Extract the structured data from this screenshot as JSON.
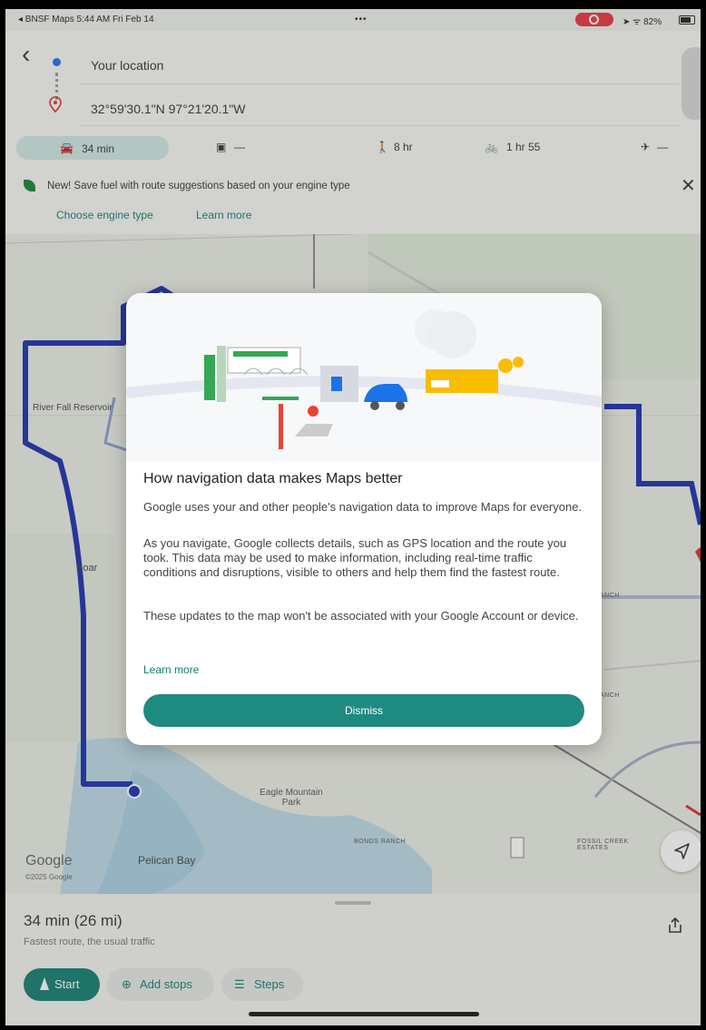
{
  "status_bar": {
    "left_text": "◂ BNSF Maps  5:44 AM  Fri Feb 14",
    "center_text": "•••",
    "right_text": "➤ ᯤ 82%"
  },
  "header": {
    "origin": "Your location",
    "destination": "32°59'30.1\"N 97°21'20.1\"W",
    "modes": [
      {
        "icon": "car-icon",
        "label": "34 min"
      },
      {
        "icon": "transit-icon",
        "label": "—"
      },
      {
        "icon": "walk-icon",
        "label": "8 hr"
      },
      {
        "icon": "bike-icon",
        "label": "1 hr 55"
      },
      {
        "icon": "flight-icon",
        "label": "—"
      }
    ]
  },
  "banner": {
    "text": "New! Save fuel with route suggestions based on your engine type",
    "links": [
      "Choose engine type",
      "Learn more"
    ]
  },
  "map": {
    "labels": [
      "Boar",
      "Pelican Bay",
      "Eagle Mountain Park"
    ],
    "small_labels": [
      "BONDS RANCH",
      "FOSSIL CREEK ESTATES",
      "ANCH",
      "ANCH"
    ],
    "logo": "Google",
    "copyright": "©2025 Google",
    "route_color": "#1a2fae"
  },
  "dialog": {
    "title": "How navigation data makes Maps better",
    "paragraphs": [
      "Google uses your and other people's navigation data to improve Maps for everyone.",
      "As you navigate, Google collects details, such as GPS location and the route you took. This data may be used to make information, including real-time traffic conditions and disruptions, visible to others and help them find the fastest route.",
      "These updates to the map won't be associated with your Google Account or device."
    ],
    "learn_more": "Learn more",
    "dismiss": "Dismiss"
  },
  "sheet": {
    "title": "34 min  (26 mi)",
    "subtitle": "Fastest route, the usual traffic",
    "start": "Start",
    "add_stops": "Add stops",
    "steps": "Steps"
  },
  "colors": {
    "accent": "#137d6f",
    "route": "#1a2fae",
    "destination_pin": "#d93025"
  }
}
